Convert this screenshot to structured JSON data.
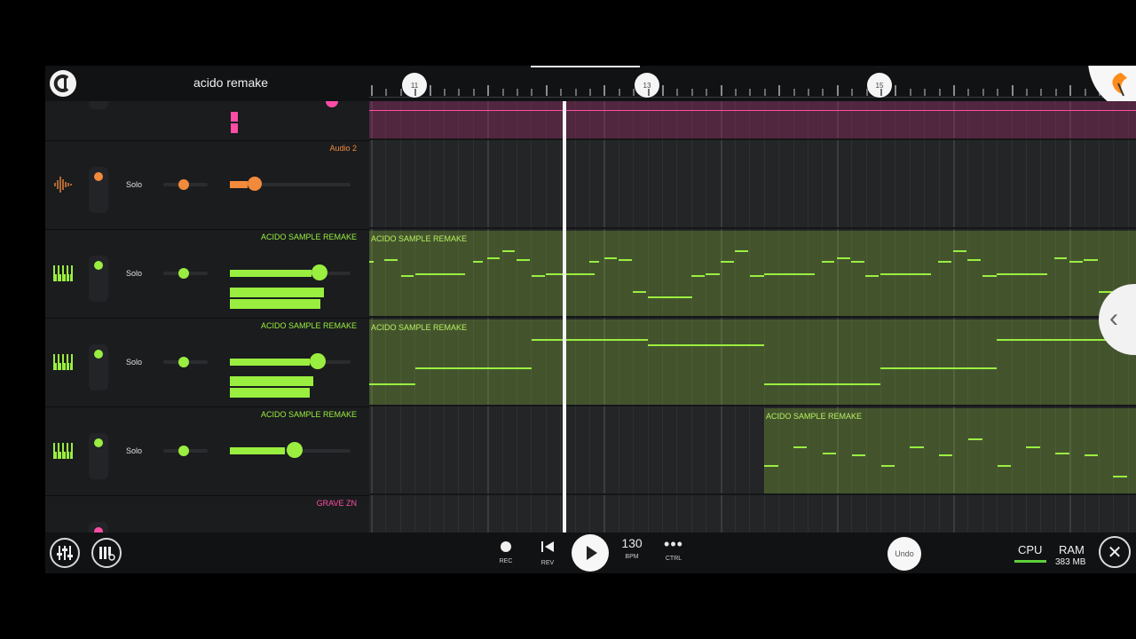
{
  "header": {
    "project_title": "acido remake",
    "bar_markers": [
      "11",
      "13",
      "15"
    ]
  },
  "tracks": [
    {
      "name": "",
      "color": "#ff4da6"
    },
    {
      "name": "Audio 2",
      "color": "#f28a3c",
      "solo_label": "Solo"
    },
    {
      "name": "ACIDO SAMPLE REMAKE",
      "color": "#9aee40",
      "solo_label": "Solo"
    },
    {
      "name": "ACIDO SAMPLE REMAKE",
      "color": "#9aee40",
      "solo_label": "Solo"
    },
    {
      "name": "ACIDO SAMPLE REMAKE",
      "color": "#9aee40",
      "solo_label": "Solo"
    },
    {
      "name": "GRAVE ZN",
      "color": "#ff4da6"
    }
  ],
  "clips": [
    "ACIDO SAMPLE REMAKE",
    "ACIDO SAMPLE REMAKE",
    "ACIDO SAMPLE REMAKE"
  ],
  "transport": {
    "rec_label": "REC",
    "rev_label": "REV",
    "bpm_value": "130",
    "bpm_label": "BPM",
    "ctrl_label": "CTRL",
    "undo_label": "Undo",
    "close_symbol": "✕"
  },
  "status": {
    "cpu_label": "CPU",
    "ram_label": "RAM",
    "ram_value": "383 MB"
  },
  "icons": [
    "logo-icon",
    "fl-logo-icon",
    "waveform-icon",
    "piano-icon",
    "mixer-icon",
    "piano-roll-settings-icon",
    "record-icon",
    "rewind-icon",
    "play-icon",
    "more-icon",
    "chevron-left-icon",
    "close-icon"
  ]
}
